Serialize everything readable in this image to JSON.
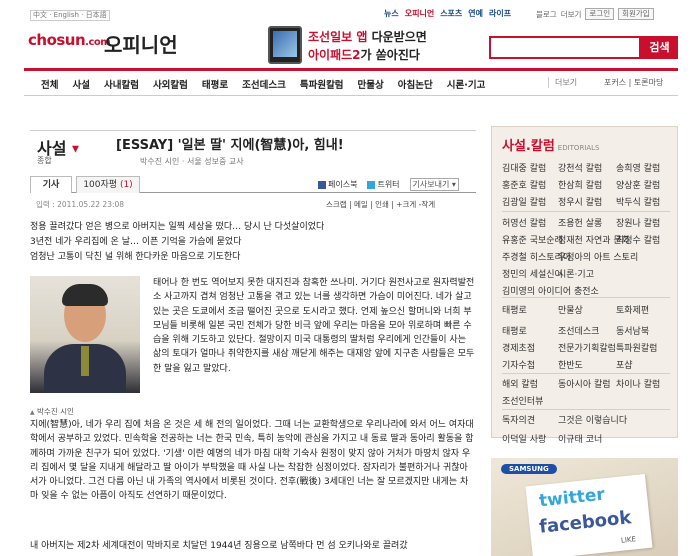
{
  "topbar": {
    "lang": "中文 · English · 日本語",
    "links": [
      "뉴스",
      "오피니언",
      "스포츠",
      "연예",
      "라이프"
    ],
    "util": [
      "블로그",
      "더보기",
      "로그인",
      "회원가입"
    ]
  },
  "header": {
    "logo": "chosun",
    "logo_suffix": ".com",
    "section": "오피니언",
    "ad_line1_a": "조선일보 앱",
    "ad_line1_b": " 다운받으면",
    "ad_line2_a": "아이패드2",
    "ad_line2_b": "가 쏟아진다",
    "search_button": "검색",
    "search_placeholder": ""
  },
  "gnb": {
    "items": [
      "전체",
      "사설",
      "사내칼럼",
      "사외칼럼",
      "태평로",
      "조선데스크",
      "특파원칼럼",
      "만물상",
      "아침논단",
      "시론·기고"
    ],
    "more": "더보기",
    "right": "포커스 | 토론마당"
  },
  "article": {
    "category": "사설",
    "subcategory": "종합",
    "headline": "[ESSAY] '일본 딸' 지에(智慧)아, 힘내!",
    "byline": "박수진 시인 · 서울 성보중 교사",
    "tabs": {
      "article": "기사",
      "comments_label": "100자평",
      "comments_count": "(1)"
    },
    "share": {
      "facebook": "페이스북",
      "twitter": "트위터",
      "more": "기사보내기 ▾"
    },
    "date": "입력 : 2011.05.22 23:08",
    "tools": "스크랩 | 메일 | 인쇄 | +크게 -작게",
    "summary": [
      "정용 끌려갔다 얻은 병으로 아버지는 일찍 세상을 떴다… 당시 난 다섯살이었다",
      "3년전 네가 우리집에 온 날… 이픈 기억을 가슴에 묻었다",
      "엄청난 고통이 닥친 널 위해 한다카운 마음으로 기도한다"
    ],
    "photo_caption": "박수진 시인",
    "body1": "태어나 한 번도 역어보지 못한 대지진과 참혹한 쓰나미. 거기다 원전사고로 원자력발전소 사고까지 겹쳐 엄청난 고통을 겪고 있는 너를 생각하면 가슴이 미어진다. 네가 살고 있는 곳은 도쿄에서 조금 떨어진 곳으로 도시라고 했다. 언제 높으신 할머니와 너희 부모님들 비롯해 일본 국민 전체가 당한 비극 앞에 우리는 마음을 모아 위로하며 빠른 수습을 위해 기도하고 있단다. 절망이지 미국 대통령의 딸처럼 우리에게 인간들이 사는 삶의 토대가 얼마나 취약한지를 새삼 깨닫게 해주는 대재앙 앞에 지구촌 사람들은 모두 한 말을 잃고 말았다.",
    "body2": "지에(智慧)아, 네가 우리 집에 처음 온 것은 세 해 전의 일이었다. 그때 너는 교환학생으로 우리나라에 와서 어느 여자대학에서 공부하고 있었다. 민속학을 전공하는 너는 한국 민속, 특히 농악에 관심을 가지고 내 동료 딸과 동아리 활동을 함께하며 가까운 친구가 되어 있었다. '기생' 이란 예명의 네가 마침 대학 기숙사 원정이 맞지 않아 거처가 마땅치 않자 우리 집에서 몇 달을 지내게 해달라고 딸 아이가 부탁했을 때 사실 나는 착잡한 심정이었다. 잠자리가 불편하거나 귀찮아서가 아니었다. 그건 다름 아닌 내 가족의 역사에서 비롯된 것이다. 전후(戰後) 3세대인 너는 잘 모르겠지만 내게는 차마 잊을 수 없는 아픔이 아직도 선연하기 때문이었다.",
    "body3": "내 아버지는 제2차 세계대전이 막바지로 치달던 1944년 징용으로 남쪽바다 먼 섬 오키나와로 끌려갔"
  },
  "editorials": {
    "title": "사설.칼럼",
    "title_en": "EDITORIALS",
    "rows": [
      [
        "김대중 칼럼",
        "강천석 칼럼",
        "송희영 칼럼"
      ],
      [
        "홍준호 칼럼",
        "한삼희 칼럼",
        "양상훈 칼럼"
      ],
      [
        "김광일 칼럼",
        "정우시 칼럼",
        "박두식 칼럼"
      ],
      [
        "허영선 칼럼",
        "조용헌 살롱",
        "장원나 칼럼"
      ],
      [
        "유홍준 국보순례",
        "정재천 자연과 문화",
        "최정수 칼럼"
      ],
      [
        "주경철 히스토리아",
        "우정아의 아트 스토리"
      ],
      [
        "정민의 세설신어",
        "시론·기고"
      ],
      [
        "김미영의 아이디어 충전소"
      ],
      [
        "태평로",
        "만물상",
        "토화제편"
      ],
      [
        "태평로",
        "조선데스크",
        "동서남북"
      ],
      [
        "경제초점",
        "전문가기획칼럼",
        "특파원칼럼"
      ],
      [
        "기자수첩",
        "한반도",
        "포샵"
      ],
      [
        "해외 칼럼",
        "동아시아 칼럼",
        "차이나 칼럼"
      ],
      [
        "조선인터뷰"
      ],
      [
        "독자의견",
        "그것은 이렇습니다"
      ],
      [
        "이덕일 사랑",
        "이규태 코너"
      ]
    ]
  },
  "ad_social": {
    "brand": "SAMSUNG",
    "twitter": "twitter",
    "facebook": "facebook",
    "like": "LIKE"
  }
}
